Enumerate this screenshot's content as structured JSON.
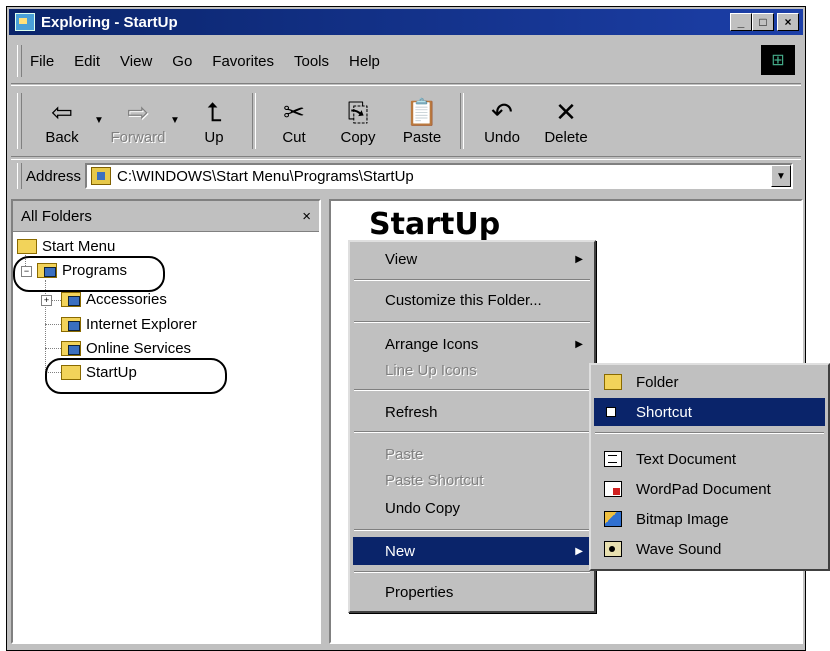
{
  "window": {
    "title": "Exploring - StartUp",
    "controls": {
      "minimize": "_",
      "maximize": "□",
      "close": "×"
    }
  },
  "menubar": {
    "items": [
      "File",
      "Edit",
      "View",
      "Go",
      "Favorites",
      "Tools",
      "Help"
    ]
  },
  "toolbar": {
    "buttons": [
      {
        "label": "Back",
        "icon": "⇦",
        "enabled": true
      },
      {
        "label": "Forward",
        "icon": "⇨",
        "enabled": false
      },
      {
        "label": "Up",
        "icon": "⮤",
        "enabled": true
      },
      {
        "label": "Cut",
        "icon": "✂",
        "enabled": true
      },
      {
        "label": "Copy",
        "icon": "⎘",
        "enabled": true
      },
      {
        "label": "Paste",
        "icon": "📋",
        "enabled": true
      },
      {
        "label": "Undo",
        "icon": "↶",
        "enabled": true
      },
      {
        "label": "Delete",
        "icon": "✕",
        "enabled": true
      }
    ]
  },
  "address": {
    "label": "Address",
    "value": "C:\\WINDOWS\\Start Menu\\Programs\\StartUp"
  },
  "folders_pane": {
    "header": "All Folders",
    "close": "×",
    "tree": [
      "Start Menu",
      "Programs",
      "Accessories",
      "Internet Explorer",
      "Online Services",
      "StartUp"
    ]
  },
  "main": {
    "title": "StartUp"
  },
  "context_menu": {
    "items": [
      "View",
      "Customize this Folder...",
      "Arrange Icons",
      "Line Up Icons",
      "Refresh",
      "Paste",
      "Paste Shortcut",
      "Undo Copy",
      "New",
      "Properties"
    ]
  },
  "new_submenu": {
    "items": [
      "Folder",
      "Shortcut",
      "Text Document",
      "WordPad Document",
      "Bitmap Image",
      "Wave Sound"
    ]
  },
  "colors": {
    "titlebar": "#0a246a",
    "highlight": "#0a246a",
    "face": "#c0c0c0"
  }
}
